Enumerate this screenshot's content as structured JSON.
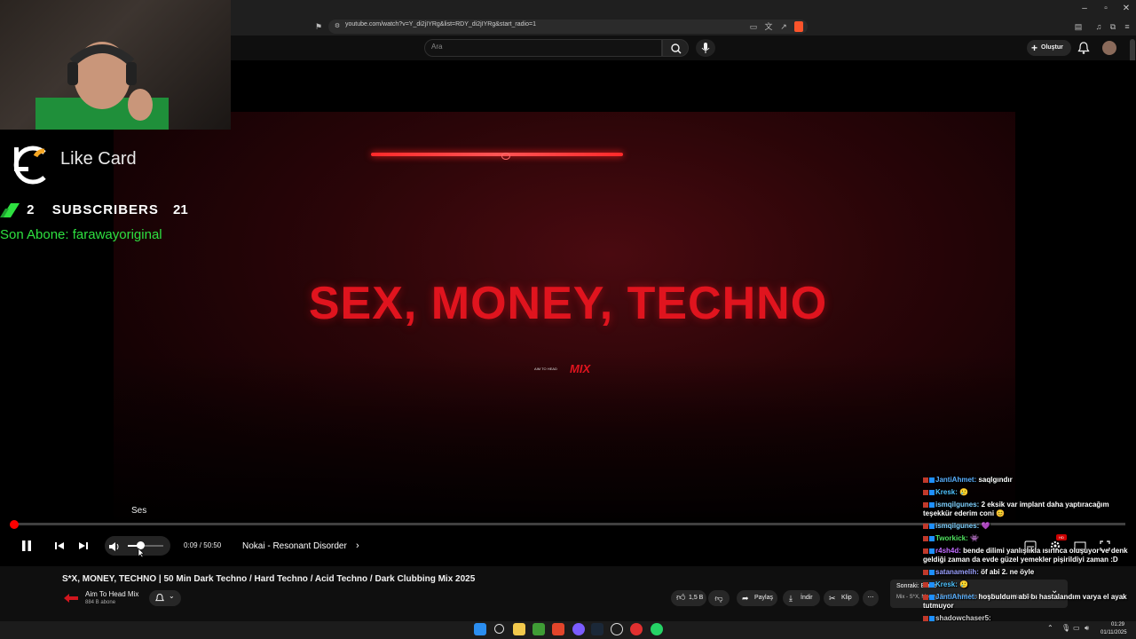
{
  "browser": {
    "url": "youtube.com/watch?v=Y_di2jIYRg&list=RDY_di2jIYRg&start_radio=1"
  },
  "header": {
    "search_placeholder": "Ara",
    "create_label": "Oluştur"
  },
  "overlay": {
    "likecard": "Like Card",
    "sub_count_left": "2",
    "subscribers_label": "SUBSCRIBERS",
    "sub_count_right": "21",
    "latest_sub": "Son Abone: farawayoriginal"
  },
  "video": {
    "frame_title": "SEX, MONEY, TECHNO",
    "frame_logo_small": "AIM TO HEAD",
    "frame_logo_mix": "MIX",
    "progress_fraction": 0.003
  },
  "player": {
    "volume_tooltip": "Ses",
    "time": "0:09 / 50:50",
    "chapter": "Nokai - Resonant Disorder",
    "volume_fraction": 0.35
  },
  "info": {
    "title": "S*X, MONEY, TECHNO | 50 Min Dark Techno / Hard Techno / Acid Techno / Dark Clubbing Mix 2025",
    "channel_name": "Aim To Head Mix",
    "channel_subs": "884 B abone",
    "like_count": "1,5 B",
    "share_label": "Paylaş",
    "download_label": "İndir",
    "clip_label": "Klip"
  },
  "next_up": {
    "label": "Sonraki: Blade",
    "title": "Mix - S*X, Money, Techno | 50 Min Dark Techno / Hard Tec..."
  },
  "chat": [
    {
      "user": "JantiAhmet",
      "color": "#5ab0ff",
      "msg": "saqlgındır"
    },
    {
      "user": "Kresk",
      "color": "#4fc3ff",
      "msg": "🥲"
    },
    {
      "user": "ismqilgunes",
      "color": "#7fd1ff",
      "msg": "2 eksik var implant daha yaptıracağım teşekkür ederim coni 😊"
    },
    {
      "user": "ismqilgunes",
      "color": "#7fd1ff",
      "msg": "💜"
    },
    {
      "user": "Tworkick",
      "color": "#4ee05e",
      "msg": "👾"
    },
    {
      "user": "r4sh4d",
      "color": "#c06cff",
      "msg": "bende dilimi yanlışlıkla ısırınca oluşuyor ve denk geldiği zaman da evde güzel yemekler pişirildiyi zaman :D"
    },
    {
      "user": "satanamelih",
      "color": "#9aa0ff",
      "msg": "öf abi 2. ne öyle"
    },
    {
      "user": "Kresk",
      "color": "#4fc3ff",
      "msg": "🥲"
    },
    {
      "user": "JantiAhmet",
      "color": "#5ab0ff",
      "msg": "hoşbuldum abi bı hastalandım varya el ayak tutmuyor"
    },
    {
      "user": "shadowchaser5",
      "color": "#cfcfcf",
      "msg": ""
    }
  ],
  "taskbar": {
    "time": "01:29",
    "date": "01/11/2025"
  },
  "colors": {
    "accent_red": "#ff0000",
    "video_title_red": "#e0141e",
    "overlay_green": "#2ee040"
  }
}
